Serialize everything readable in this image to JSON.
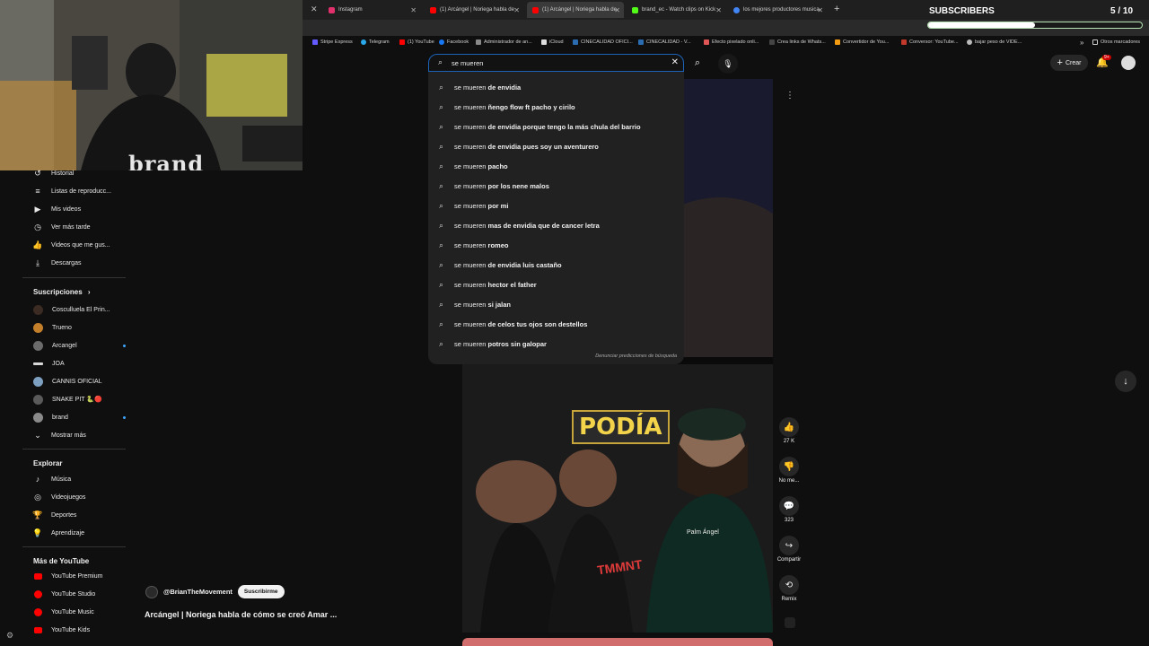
{
  "tabs": [
    {
      "label": "Instagram",
      "color": "#e1306c",
      "active": false
    },
    {
      "label": "(1) Arcángel | Noriega habla de",
      "color": "#ff0000",
      "active": false
    },
    {
      "label": "(1) Arcángel | Noriega habla de",
      "color": "#ff0000",
      "active": true
    },
    {
      "label": "brand_ec - Watch clips on Kick",
      "color": "#53fc18",
      "active": false
    },
    {
      "label": "los mejores productores musica",
      "color": "#4285f4",
      "active": false
    }
  ],
  "bookmarks": [
    "Stripe Express",
    "Telegram",
    "(1) YouTube",
    "Facebook",
    "Administrador de an...",
    "iCloud",
    "CINECALIDAD OFICI...",
    "CINECALIDAD - V...",
    "Efecto pixelado onli...",
    "Crea links de Whats...",
    "Convertidor de You...",
    "Conversor: YouTube...",
    "bajar peso de VIDE...",
    "Otros marcadores"
  ],
  "overlay": {
    "subscribers_label": "SUBSCRIBERS",
    "subscribers_count": "5 / 10",
    "progress_fraction": 0.5,
    "webcam_text": "brand"
  },
  "search": {
    "query": "se mueren",
    "report_text": "Denunciar predicciones de búsqueda",
    "suggestions": [
      {
        "prefix": "se mueren",
        "suffix": " de envidia"
      },
      {
        "prefix": "se mueren",
        "suffix": " ñengo flow ft pacho y cirilo"
      },
      {
        "prefix": "se mueren",
        "suffix": " de envidia porque tengo la más chula del barrio"
      },
      {
        "prefix": "se mueren",
        "suffix": " de envidia pues soy un aventurero"
      },
      {
        "prefix": "se mueren",
        "suffix": " pacho"
      },
      {
        "prefix": "se mueren",
        "suffix": " por los nene malos"
      },
      {
        "prefix": "se mueren",
        "suffix": " por mi"
      },
      {
        "prefix": "se mueren",
        "suffix": " mas de envidia que de cancer letra"
      },
      {
        "prefix": "se mueren",
        "suffix": " romeo"
      },
      {
        "prefix": "se mueren",
        "suffix": " de envidia luis castaño"
      },
      {
        "prefix": "se mueren",
        "suffix": " hector el father"
      },
      {
        "prefix": "se mueren",
        "suffix": " si jalan"
      },
      {
        "prefix": "se mueren",
        "suffix": " de celos tus ojos son destellos"
      },
      {
        "prefix": "se mueren",
        "suffix": " potros sin galopar"
      }
    ]
  },
  "header": {
    "create_label": "Crear",
    "notif_count": "9+"
  },
  "sidebar": {
    "you_items": [
      {
        "icon": "history-icon",
        "glyph": "↺",
        "label": "Historial"
      },
      {
        "icon": "playlist-icon",
        "glyph": "≡",
        "label": "Listas de reproducc..."
      },
      {
        "icon": "my-videos-icon",
        "glyph": "▶",
        "label": "Mis videos"
      },
      {
        "icon": "watch-later-icon",
        "glyph": "◷",
        "label": "Ver más tarde"
      },
      {
        "icon": "liked-icon",
        "glyph": "👍",
        "label": "Videos que me gus..."
      },
      {
        "icon": "download-icon",
        "glyph": "⤓",
        "label": "Descargas"
      }
    ],
    "subscriptions_title": "Suscripciones",
    "subscriptions": [
      {
        "label": "Cosculluela El Prin...",
        "color": "#3b2b22",
        "dot": false
      },
      {
        "label": "Trueno",
        "color": "#c47f2b",
        "dot": false
      },
      {
        "label": "Arcangel",
        "color": "#6b6b6b",
        "dot": true
      },
      {
        "label": "JOA",
        "color": "#d8d8d8",
        "dot": false
      },
      {
        "label": "CANNIS OFICIAL",
        "color": "#7da0c0",
        "dot": false
      },
      {
        "label": "SNAKE PIT 🐍🔴",
        "color": "#5a5a5a",
        "dot": false
      },
      {
        "label": "brand",
        "color": "#8a8a8a",
        "dot": true
      }
    ],
    "show_more": "Mostrar más",
    "explore_title": "Explorar",
    "explore": [
      {
        "icon": "music-icon",
        "glyph": "♪",
        "label": "Música"
      },
      {
        "icon": "gaming-icon",
        "glyph": "◎",
        "label": "Videojuegos"
      },
      {
        "icon": "trophy-icon",
        "glyph": "🏆",
        "label": "Deportes"
      },
      {
        "icon": "learning-icon",
        "glyph": "💡",
        "label": "Aprendizaje"
      }
    ],
    "more_title": "Más de YouTube",
    "more": [
      {
        "label": "YouTube Premium"
      },
      {
        "label": "YouTube Studio"
      },
      {
        "label": "YouTube Music"
      },
      {
        "label": "YouTube Kids"
      }
    ]
  },
  "video": {
    "channel": "@BrianTheMovement",
    "subscribe_label": "Suscribirme",
    "title": "Arcángel | Noriega habla de cómo se creó Amar ...",
    "overlay_text": "PODÍA",
    "logo_text": "TMMNT",
    "shirt_text": "Palm Ángel"
  },
  "actions": [
    {
      "name": "like",
      "glyph": "👍",
      "label": "27 K"
    },
    {
      "name": "dislike",
      "glyph": "👎",
      "label": "No me..."
    },
    {
      "name": "comments",
      "glyph": "💬",
      "label": "323"
    },
    {
      "name": "share",
      "glyph": "↪",
      "label": "Compartir"
    },
    {
      "name": "remix",
      "glyph": "⟲",
      "label": "Remix"
    }
  ]
}
